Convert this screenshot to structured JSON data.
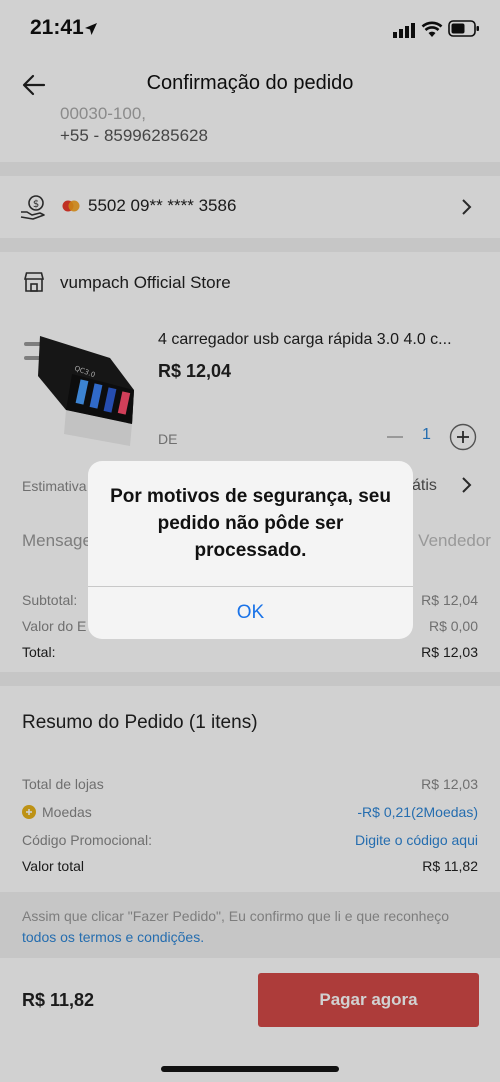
{
  "status": {
    "time": "21:41"
  },
  "header": {
    "title": "Confirmação do pedido"
  },
  "address": {
    "clipped_line": "00030-100,",
    "phone": "+55 - 85996285628"
  },
  "payment": {
    "card_number": "5502 09** **** 3586"
  },
  "store": {
    "name": "vumpach Official Store",
    "product": {
      "title": "4 carregador usb carga rápida 3.0 4.0 c...",
      "price": "R$ 12,04",
      "variant": "DE",
      "quantity": "1"
    },
    "shipping_label": "Estimativa",
    "shipping_value": "átis",
    "message_label": "Mensage",
    "message_placeholder": "o Vendedor",
    "subtotal_label": "Subtotal:",
    "subtotal_value": "R$ 12,04",
    "shipping_cost_label": "Valor do E",
    "shipping_cost_value": "R$ 0,00",
    "total_label": "Total:",
    "total_value": "R$ 12,03"
  },
  "summary": {
    "title": "Resumo do Pedido (1 itens)",
    "stores_label": "Total de lojas",
    "stores_value": "R$ 12,03",
    "coins_label": "Moedas",
    "coins_value": "-R$ 0,21(2Moedas)",
    "promo_label": "Código Promocional:",
    "promo_value": "Digite o código aqui",
    "grand_label": "Valor total",
    "grand_value": "R$ 11,82"
  },
  "terms": {
    "text": "Assim que clicar \"Fazer Pedido\", Eu confirmo que li e que reconheço",
    "link": "todos os termos e condições."
  },
  "bottom": {
    "total": "R$ 11,82",
    "pay_button": "Pagar agora"
  },
  "dialog": {
    "message": "Por motivos de segurança, seu pedido não pôde ser processado.",
    "ok": "OK"
  }
}
